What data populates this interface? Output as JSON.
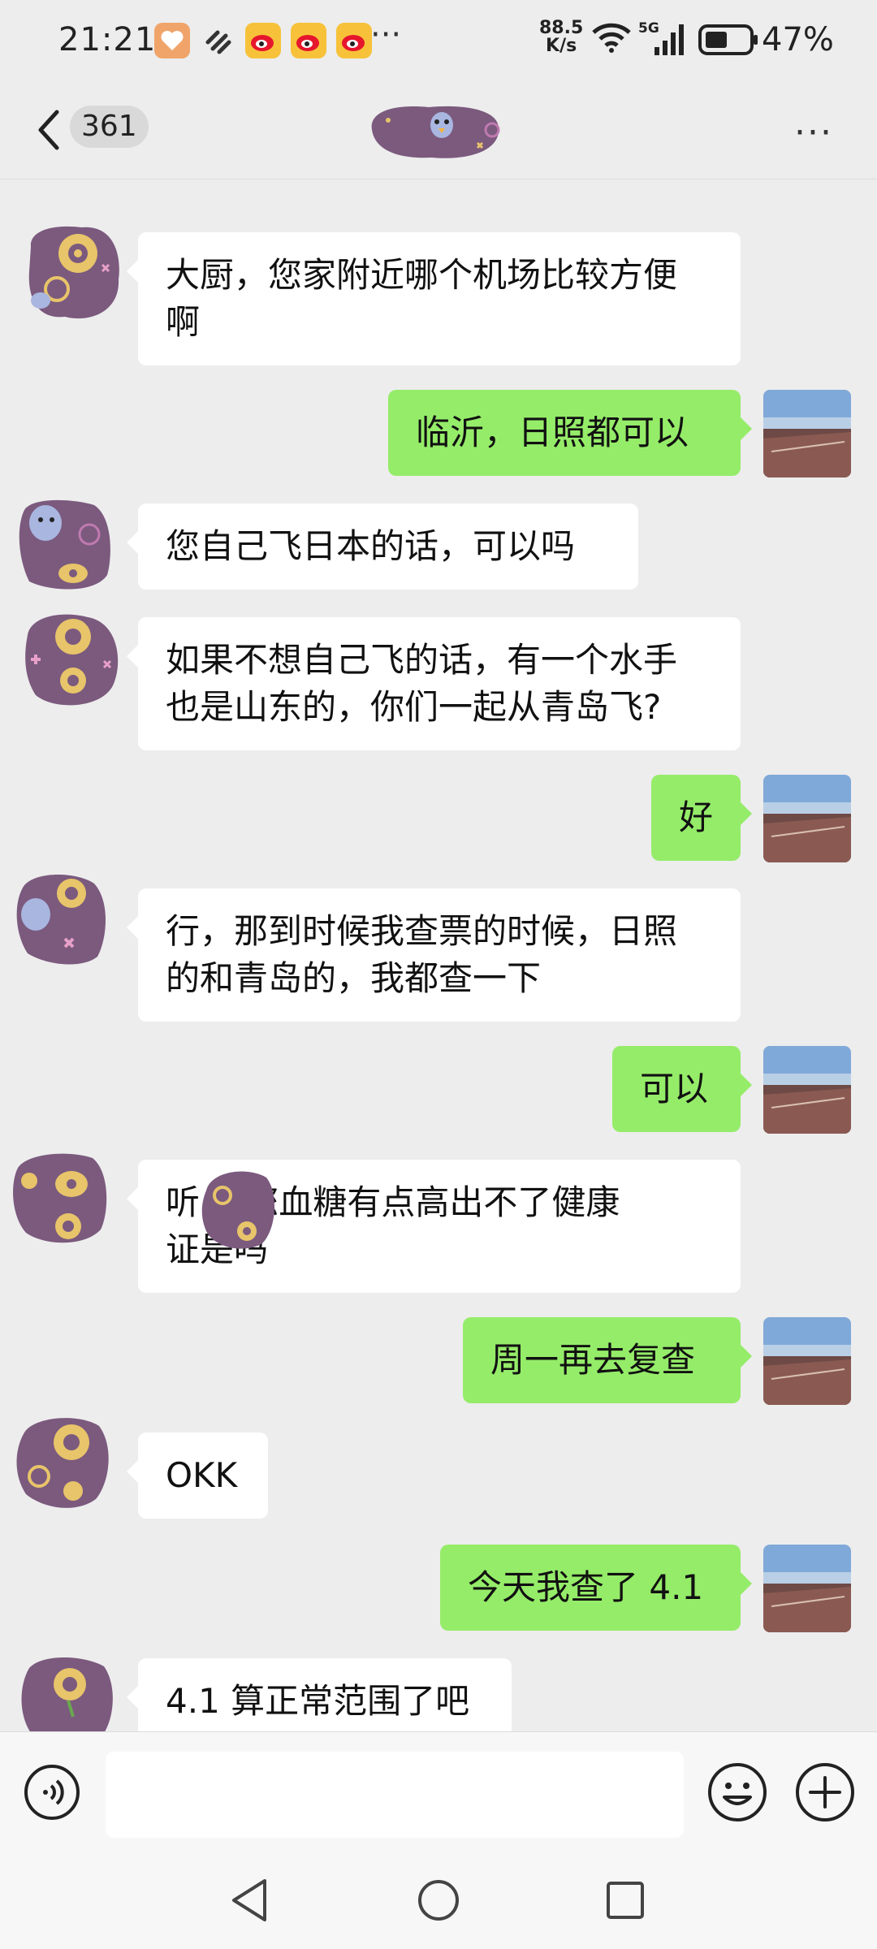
{
  "status_bar": {
    "time": "21:21",
    "net_speed_value": "88.5",
    "net_speed_unit": "K/s",
    "network_label": "5G",
    "battery": "47%",
    "more": "···"
  },
  "header": {
    "unread_count": "361",
    "more": "···"
  },
  "messages": [
    {
      "side": "in",
      "lines": [
        "大厨，您家附近哪个机场比较方便",
        "啊"
      ]
    },
    {
      "side": "out",
      "lines": [
        "临沂，日照都可以"
      ]
    },
    {
      "side": "in",
      "lines": [
        "您自己飞日本的话，可以吗"
      ]
    },
    {
      "side": "in",
      "lines": [
        "如果不想自己飞的话，有一个水手",
        "也是山东的，你们一起从青岛飞?"
      ]
    },
    {
      "side": "out",
      "lines": [
        "好"
      ]
    },
    {
      "side": "in",
      "lines": [
        "行，那到时候我查票的时候，日照",
        "的和青岛的，我都查一下"
      ]
    },
    {
      "side": "out",
      "lines": [
        "可以"
      ]
    },
    {
      "side": "in",
      "lines": [
        "听    说您血糖有点高出不了健康",
        "证是吗"
      ]
    },
    {
      "side": "out",
      "lines": [
        "周一再去复查"
      ]
    },
    {
      "side": "in",
      "lines": [
        "OKK"
      ]
    },
    {
      "side": "out",
      "lines": [
        "今天我查了 4.1"
      ]
    },
    {
      "side": "in",
      "lines": [
        "4.1 算正常范围了吧"
      ]
    }
  ],
  "input": {
    "placeholder": ""
  },
  "icons": {
    "back": "chevron-left-icon",
    "more": "more-dots-icon",
    "voice": "voice-icon",
    "emoji": "emoji-icon",
    "plus": "plus-icon",
    "nav_back": "triangle-back-icon",
    "nav_home": "circle-home-icon",
    "nav_recent": "square-recent-icon"
  },
  "colors": {
    "background": "#ededed",
    "outgoing_bubble": "#95ec69",
    "incoming_bubble": "#ffffff",
    "avatar_purple": "#7b5a7e"
  }
}
